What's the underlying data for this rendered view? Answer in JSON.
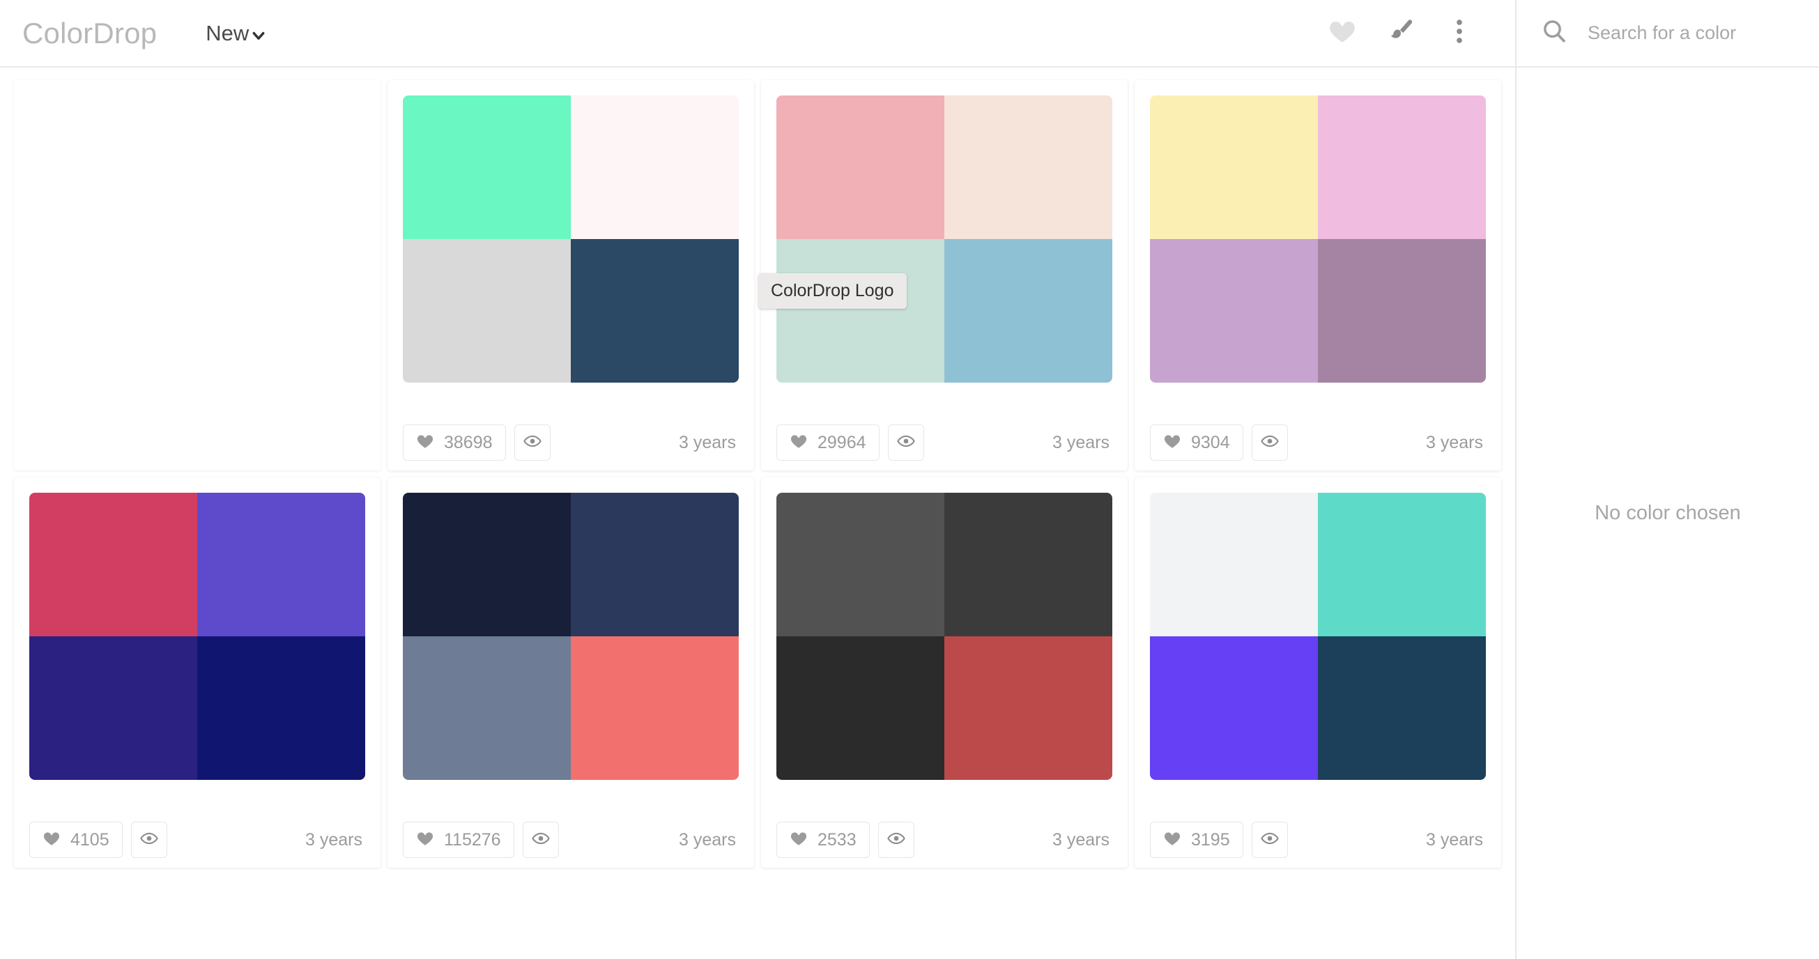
{
  "header": {
    "brand": "ColorDrop",
    "nav_label": "New",
    "chevron_icon": "chevron-down-icon",
    "actions": [
      {
        "icon": "heart-icon",
        "name": "favorites-button",
        "color": "#e0e0e0"
      },
      {
        "icon": "paintbrush-icon",
        "name": "paintbrush-button",
        "color": "#8c8c8c"
      },
      {
        "icon": "more-vertical-icon",
        "name": "more-options-button",
        "color": "#8c8c8c"
      }
    ]
  },
  "search": {
    "icon": "search-icon",
    "placeholder": "Search for a color",
    "value": ""
  },
  "sidebar": {
    "empty_state": "No color chosen"
  },
  "tooltip": {
    "text": "ColorDrop Logo"
  },
  "labels": {
    "heart_icon": "heart-icon",
    "eye_icon": "eye-icon",
    "likes_aria": "likes",
    "views_aria": "views"
  },
  "palettes": [
    {
      "id": "placeholder-card",
      "blank": true,
      "colors": [],
      "likes": "",
      "age": ""
    },
    {
      "id": "palette-1",
      "blank": false,
      "colors": [
        "#6af7c1",
        "#fdf5f6",
        "#d9d9d9",
        "#2b4865"
      ],
      "likes": "38698",
      "age": "3 years"
    },
    {
      "id": "palette-2",
      "blank": false,
      "colors": [
        "#f0b0b5",
        "#f6e3d9",
        "#c7e0d8",
        "#8fc1d4"
      ],
      "likes": "29964",
      "age": "3 years"
    },
    {
      "id": "palette-3",
      "blank": false,
      "colors": [
        "#fcefb4",
        "#f0bcdf",
        "#c7a3cf",
        "#a584a3"
      ],
      "likes": "9304",
      "age": "3 years"
    },
    {
      "id": "palette-4",
      "blank": false,
      "colors": [
        "#d13e62",
        "#5d4bcb",
        "#2a2180",
        "#101670"
      ],
      "likes": "4105",
      "age": "3 years"
    },
    {
      "id": "palette-5",
      "blank": false,
      "colors": [
        "#182039",
        "#2b3a5c",
        "#6e7c95",
        "#f2716e"
      ],
      "likes": "115276",
      "age": "3 years"
    },
    {
      "id": "palette-6",
      "blank": false,
      "colors": [
        "#525252",
        "#3b3b3b",
        "#2b2b2b",
        "#bd4a4b"
      ],
      "likes": "2533",
      "age": "3 years"
    },
    {
      "id": "palette-7",
      "blank": false,
      "colors": [
        "#f1f3f5",
        "#5edbc8",
        "#6540f5",
        "#1c4059"
      ],
      "likes": "3195",
      "age": "3 years"
    }
  ]
}
